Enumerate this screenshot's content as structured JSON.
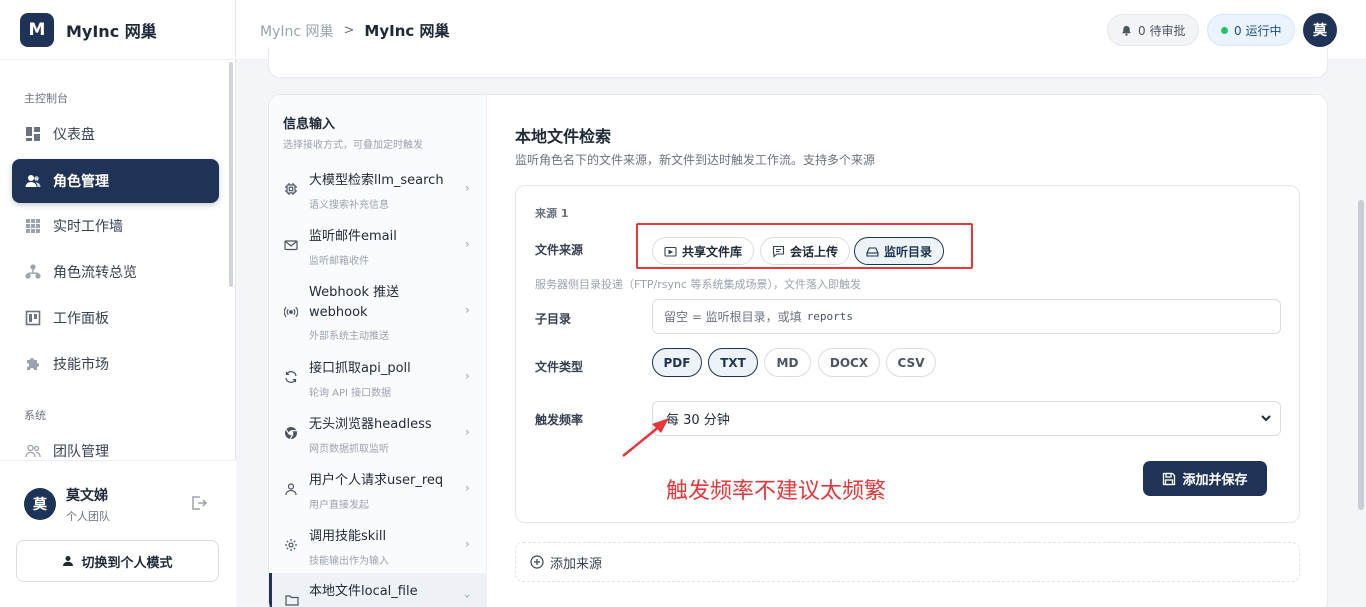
{
  "brand": {
    "logo_letter": "M",
    "name": "MyInc 网巢"
  },
  "nav": {
    "group_main": "主控制台",
    "items": [
      {
        "label": "仪表盘",
        "icon": "dashboard-icon"
      },
      {
        "label": "角色管理",
        "icon": "users-icon",
        "active": true
      },
      {
        "label": "实时工作墙",
        "icon": "grid-icon"
      },
      {
        "label": "角色流转总览",
        "icon": "flow-icon"
      },
      {
        "label": "工作面板",
        "icon": "board-icon"
      },
      {
        "label": "技能市场",
        "icon": "puzzle-icon"
      }
    ],
    "group_system": "系统",
    "system_items": [
      {
        "label": "团队管理",
        "icon": "team-icon"
      }
    ]
  },
  "user": {
    "avatar": "莫",
    "name": "莫文娣",
    "team": "个人团队",
    "mode_button": "切换到个人模式"
  },
  "header": {
    "breadcrumb_prev": "MyInc 网巢",
    "breadcrumb_sep": ">",
    "breadcrumb_current": "MyInc 网巢",
    "approve_pill": "0 待审批",
    "running_pill": "0 运行中",
    "avatar": "莫"
  },
  "info_input": {
    "title": "信息输入",
    "subtitle": "选择接收方式，可叠加定时触发",
    "sources": [
      {
        "name": "大模型检索llm_search",
        "desc": "语义搜索补充信息",
        "icon": "cpu-icon"
      },
      {
        "name": "监听邮件email",
        "desc": "监听邮箱收件",
        "icon": "mail-icon"
      },
      {
        "name": "Webhook 推送 webhook",
        "name_line1": "Webhook 推送",
        "name_line2": "webhook",
        "desc": "外部系统主动推送",
        "icon": "broadcast-icon"
      },
      {
        "name": "接口抓取api_poll",
        "desc": "轮询 API 接口数据",
        "icon": "refresh-icon"
      },
      {
        "name": "无头浏览器headless",
        "desc": "网页数据抓取监听",
        "icon": "browser-icon"
      },
      {
        "name": "用户个人请求user_req",
        "desc": "用户直接发起",
        "icon": "user-icon"
      },
      {
        "name": "调用技能skill",
        "desc": "技能输出作为输入",
        "icon": "gear-icon"
      },
      {
        "name": "本地文件local_file",
        "desc": "",
        "icon": "folder-icon",
        "active": true
      }
    ]
  },
  "local_file": {
    "title": "本地文件检索",
    "subtitle": "监听角色名下的文件来源，新文件到达时触发工作流。支持多个来源",
    "source_label": "来源 1",
    "file_source_label": "文件来源",
    "file_source_options": [
      {
        "label": "共享文件库",
        "icon": "folder-share-icon"
      },
      {
        "label": "会话上传",
        "icon": "chat-icon"
      },
      {
        "label": "监听目录",
        "icon": "drive-icon",
        "selected": true
      }
    ],
    "hint": "服务器侧目录投递（FTP/rsync 等系统集成场景），文件落入即触发",
    "subdir_label": "子目录",
    "subdir_placeholder": "留空 = 监听根目录，或填",
    "subdir_placeholder_code": "reports",
    "file_type_label": "文件类型",
    "file_types": [
      {
        "label": "PDF",
        "selected": true
      },
      {
        "label": "TXT",
        "selected": true
      },
      {
        "label": "MD",
        "selected": false
      },
      {
        "label": "DOCX",
        "selected": false
      },
      {
        "label": "CSV",
        "selected": false
      }
    ],
    "trigger_label": "触发频率",
    "trigger_value": "每 30 分钟",
    "annotation": "触发频率不建议太频繁",
    "save_button": "添加并保存",
    "add_source": "添加来源"
  },
  "colors": {
    "primary": "#1e3356",
    "annotation_red": "#e5383b",
    "running_dot": "#22c55e"
  }
}
